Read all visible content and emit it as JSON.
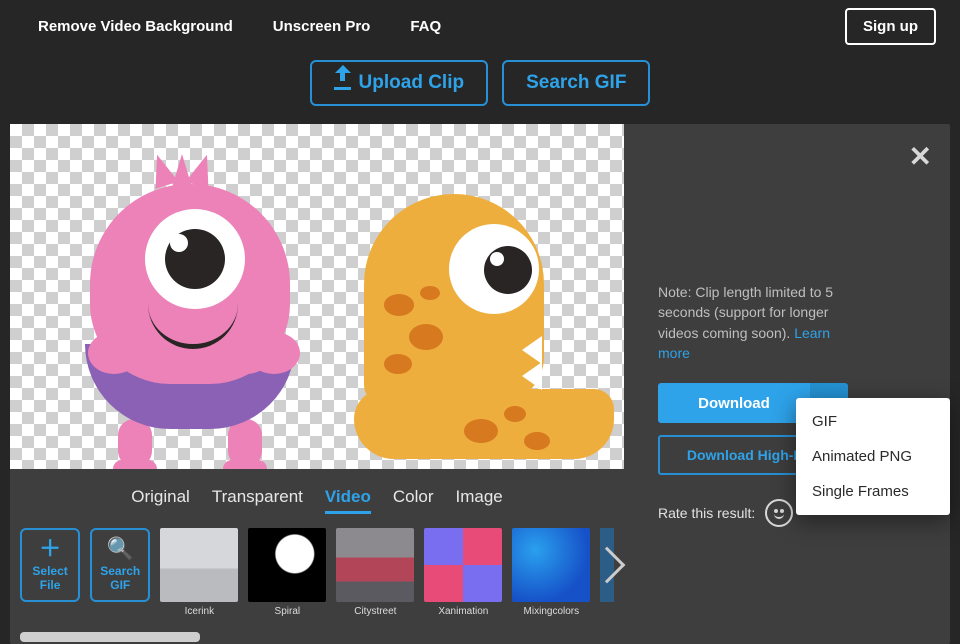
{
  "nav": {
    "items": [
      "Remove Video Background",
      "Unscreen Pro",
      "FAQ"
    ],
    "signup": "Sign up"
  },
  "actions": {
    "upload": "Upload Clip",
    "search_gif": "Search GIF"
  },
  "tabs": [
    "Original",
    "Transparent",
    "Video",
    "Color",
    "Image"
  ],
  "tools": {
    "select_file": "Select File",
    "search_gif": "Search GIF"
  },
  "thumbs": [
    {
      "label": "Icerink",
      "cls": "icerink"
    },
    {
      "label": "Spiral",
      "cls": "spiral"
    },
    {
      "label": "Citystreet",
      "cls": "city"
    },
    {
      "label": "Xanimation",
      "cls": "xanim"
    },
    {
      "label": "Mixingcolors",
      "cls": "mix"
    }
  ],
  "side": {
    "note_prefix": "Note: Clip length limited to 5 seconds (support for longer videos coming soon). ",
    "learn_more": "Learn more",
    "download": "Download",
    "download_hires": "Download High-Res",
    "rate_label": "Rate this result:"
  },
  "dropdown": [
    "GIF",
    "Animated PNG",
    "Single Frames"
  ]
}
